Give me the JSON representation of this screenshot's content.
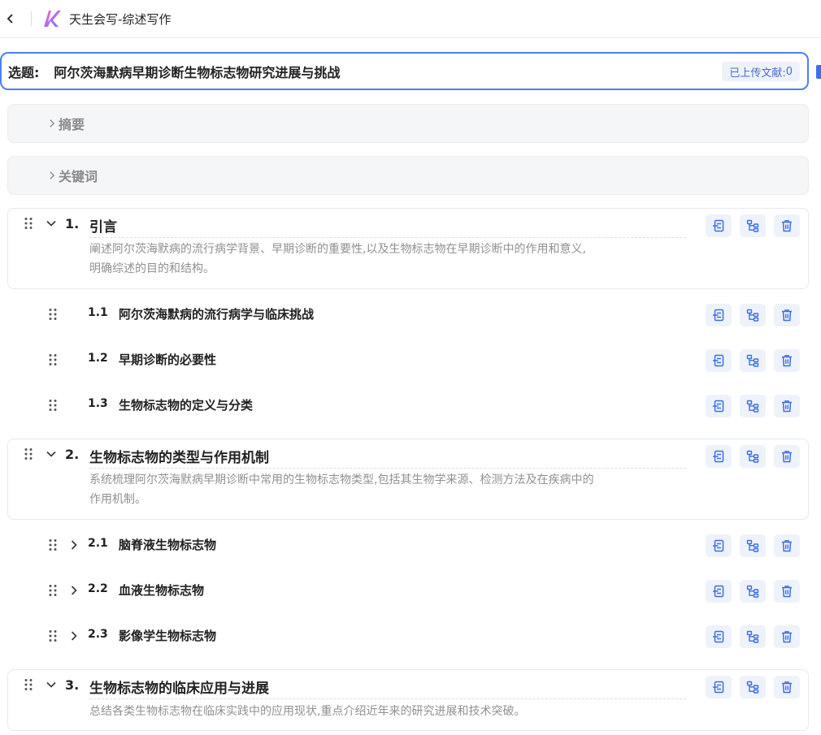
{
  "header": {
    "app_title": "天生会写-综述写作"
  },
  "topic": {
    "label": "选题:",
    "text": "阿尔茨海默病早期诊断生物标志物研究进展与挑战",
    "uploaded_label": "已上传文献:",
    "uploaded_count": "0"
  },
  "collapsibles": [
    {
      "label": "摘要"
    },
    {
      "label": "关键词"
    }
  ],
  "sections": [
    {
      "number": "1.",
      "title": "引言",
      "description": [
        "阐述阿尔茨海默病的流行病学背景、早期诊断的重要性,以及生物标志物在早期诊断中的作用和意义,",
        "明确综述的目的和结构。"
      ],
      "subsections": [
        {
          "number": "1.1",
          "title": "阿尔茨海默病的流行病学与临床挑战"
        },
        {
          "number": "1.2",
          "title": "早期诊断的必要性"
        },
        {
          "number": "1.3",
          "title": "生物标志物的定义与分类"
        }
      ]
    },
    {
      "number": "2.",
      "title": "生物标志物的类型与作用机制",
      "description": [
        "系统梳理阿尔茨海默病早期诊断中常用的生物标志物类型,包括其生物学来源、检测方法及在疾病中的",
        "作用机制。"
      ],
      "subsections": [
        {
          "number": "2.1",
          "title": "脑脊液生物标志物"
        },
        {
          "number": "2.2",
          "title": "血液生物标志物"
        },
        {
          "number": "2.3",
          "title": "影像学生物标志物"
        }
      ]
    },
    {
      "number": "3.",
      "title": "生物标志物的临床应用与进展",
      "description": [
        "总结各类生物标志物在临床实践中的应用现状,重点介绍近年来的研究进展和技术突破。"
      ],
      "subsections": []
    }
  ],
  "icons": {
    "back": "chevron-left-icon",
    "logo": "app-logo",
    "expand": "chevron-down-icon",
    "collapsed": "chevron-right-icon",
    "drag": "drag-handle-icon",
    "action_1": "insert-section-icon",
    "action_2": "add-subsection-icon",
    "action_3": "delete-icon"
  },
  "colors": {
    "accent": "#4d7ef7",
    "action_bg": "#eef2fb",
    "icon": "#3a6fe0",
    "muted_text": "#909090"
  }
}
